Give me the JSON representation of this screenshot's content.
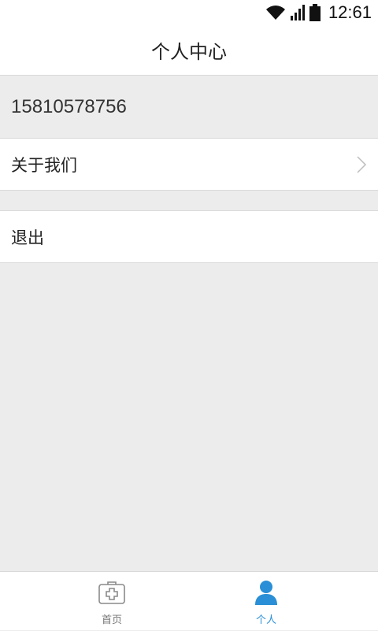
{
  "status_bar": {
    "time": "12:61",
    "icons": [
      "wifi-icon",
      "signal-icon",
      "battery-icon"
    ]
  },
  "header": {
    "title": "个人中心"
  },
  "profile": {
    "phone": "15810578756"
  },
  "menu": {
    "about_label": "关于我们",
    "logout_label": "退出"
  },
  "tab_bar": {
    "tabs": [
      {
        "label": "首页",
        "icon": "medical-kit-icon",
        "active": false
      },
      {
        "label": "个人",
        "icon": "user-icon",
        "active": true
      }
    ]
  },
  "colors": {
    "accent": "#2a8fd6",
    "background": "#ececec",
    "surface": "#ffffff",
    "divider": "#d9d9d9"
  }
}
